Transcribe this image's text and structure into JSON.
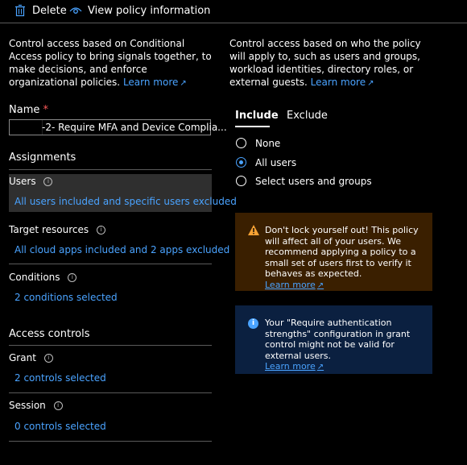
{
  "toolbar": {
    "delete_label": "Delete",
    "view_policy_label": "View policy information"
  },
  "left": {
    "intro": "Control access based on Conditional Access policy to bring signals together, to make decisions, and enforce organizational policies.",
    "learn_more": "Learn more",
    "name_label": "Name",
    "required_marker": "*",
    "name_value": "-2- Require MFA and Device Complia...",
    "assignments_heading": "Assignments",
    "users_label": "Users",
    "users_value": "All users included and specific users excluded",
    "target_label": "Target resources",
    "target_value": "All cloud apps included and 2 apps excluded",
    "conditions_label": "Conditions",
    "conditions_value": "2 conditions selected",
    "access_heading": "Access controls",
    "grant_label": "Grant",
    "grant_value": "2 controls selected",
    "session_label": "Session",
    "session_value": "0 controls selected"
  },
  "right": {
    "intro": "Control access based on who the policy will apply to, such as users and groups, workload identities, directory roles, or external guests.",
    "learn_more": "Learn more",
    "tabs": {
      "include": "Include",
      "exclude": "Exclude"
    },
    "options": {
      "none": "None",
      "all": "All users",
      "select": "Select users and groups"
    },
    "selected_option": "All users",
    "warning": {
      "text": "Don't lock yourself out! This policy will affect all of your users. We recommend applying a policy to a small set of users first to verify it behaves as expected.",
      "learn_more": "Learn more"
    },
    "info": {
      "text": "Your \"Require authentication strengths\" configuration in grant control might not be valid for external users.",
      "learn_more": "Learn more"
    }
  },
  "colors": {
    "accent": "#4aa3ff",
    "warning_bg": "#3a1f00",
    "warning_icon": "#f7a234",
    "info_bg": "#0b2040",
    "info_icon": "#4aa3ff",
    "selected_row": "#2f2f2f"
  }
}
